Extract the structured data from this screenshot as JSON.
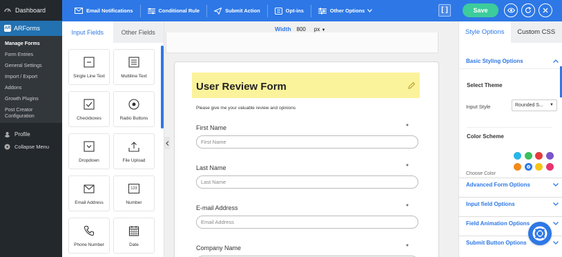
{
  "wp_sidebar": {
    "dashboard": "Dashboard",
    "arforms": "ARForms",
    "arforms_icon_text": "AR",
    "submenu": [
      "Manage Forms",
      "Form Entries",
      "General Settings",
      "Import / Export",
      "Addons",
      "Growth Plugins",
      "Post Creator Configuration"
    ],
    "profile": "Profile",
    "collapse": "Collapse Menu"
  },
  "toolbar": {
    "email_notifications": "Email Notifications",
    "conditional_rule": "Conditional Rule",
    "submit_action": "Submit Action",
    "opt_ins": "Opt-ins",
    "other_options": "Other Options",
    "brackets": "[ ]",
    "save": "Save"
  },
  "field_panel": {
    "tabs": [
      "Input Fields",
      "Other Fields"
    ],
    "fields": [
      {
        "label": "Single Line Text",
        "icon": "single-line-text-icon"
      },
      {
        "label": "Multiline Text",
        "icon": "multiline-text-icon"
      },
      {
        "label": "Checkboxes",
        "icon": "checkbox-icon"
      },
      {
        "label": "Radio Buttons",
        "icon": "radio-icon"
      },
      {
        "label": "Dropdown",
        "icon": "dropdown-icon"
      },
      {
        "label": "File Upload",
        "icon": "upload-icon"
      },
      {
        "label": "Email Address",
        "icon": "email-icon"
      },
      {
        "label": "Number",
        "icon": "number-icon"
      },
      {
        "label": "Phone Number",
        "icon": "phone-icon"
      },
      {
        "label": "Date",
        "icon": "calendar-icon"
      }
    ],
    "number_icon_text": "123"
  },
  "canvas": {
    "width_label": "Width",
    "width_value": "800",
    "width_unit": "px"
  },
  "form": {
    "title": "User Review Form",
    "description": "Please give me your valuable review and opinions",
    "required_mark": "*",
    "fields": [
      {
        "label": "First Name",
        "placeholder": "First Name"
      },
      {
        "label": "Last Name",
        "placeholder": "Last Name"
      },
      {
        "label": "E-mail Address",
        "placeholder": "Email Address"
      },
      {
        "label": "Company Name",
        "placeholder": ""
      }
    ]
  },
  "right_panel": {
    "tabs": [
      "Style Options",
      "Custom CSS"
    ],
    "basic_styling": "Basic Styling Options",
    "select_theme": "Select Theme",
    "input_style_label": "Input Style",
    "input_style_value": "Rounded S...",
    "color_scheme": "Color Scheme",
    "swatches": [
      "#29b6e8",
      "#3cbf5e",
      "#e53b3b",
      "#7b54c9",
      "#f28a1b",
      "#2d78e6",
      "#f5c518",
      "#e8336e"
    ],
    "cut_text": "Choose Color",
    "sections": [
      "Advanced Form Options",
      "Input field Options",
      "Field Animation Options",
      "Submit Button Options"
    ]
  }
}
